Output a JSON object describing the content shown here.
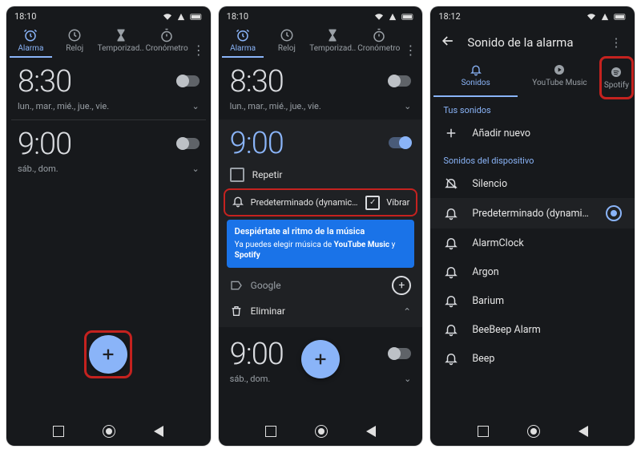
{
  "status": {
    "time1": "18:10",
    "time2": "18:10",
    "time3": "18:12"
  },
  "tabs": {
    "alarm": "Alarma",
    "clock": "Reloj",
    "timer": "Temporizad..",
    "stopwatch": "Cronómetro"
  },
  "screen1": {
    "alarms": [
      {
        "time": "8:30",
        "days": "lun., mar., mié., jue., vie.",
        "on": false
      },
      {
        "time": "9:00",
        "days": "sáb., dom.",
        "on": false
      }
    ]
  },
  "screen2": {
    "alarm_off": {
      "time": "8:30",
      "days": "lun., mar., mié., jue., vie."
    },
    "alarm_on": {
      "time": "9:00"
    },
    "repeat": "Repetir",
    "sound_label": "Predeterminado (dynamic_alar..",
    "vibrate": "Vibrar",
    "tooltip_title": "Despiértate al ritmo de la música",
    "tooltip_body_pre": "Ya puedes elegir música de ",
    "tooltip_body_a": "YouTube Music",
    "tooltip_body_mid": " y ",
    "tooltip_body_b": "Spotify",
    "label_placeholder": "Google",
    "delete": "Eliminar",
    "collapsed_alarm": {
      "time": "9:00",
      "days": "sáb., dom."
    }
  },
  "screen3": {
    "title": "Sonido de la alarma",
    "tabs": {
      "sounds": "Sonidos",
      "yt": "YouTube Music",
      "spotify": "Spotify"
    },
    "your_sounds": "Tus sonidos",
    "add_new": "Añadir nuevo",
    "device_sounds": "Sonidos del dispositivo",
    "items": [
      {
        "name": "Silencio",
        "icon": "mute"
      },
      {
        "name": "Predeterminado (dynamic_alarm...",
        "icon": "bell",
        "selected": true
      },
      {
        "name": "AlarmClock",
        "icon": "bell"
      },
      {
        "name": "Argon",
        "icon": "bell"
      },
      {
        "name": "Barium",
        "icon": "bell"
      },
      {
        "name": "BeeBeep Alarm",
        "icon": "bell"
      },
      {
        "name": "Beep",
        "icon": "bell"
      }
    ]
  }
}
